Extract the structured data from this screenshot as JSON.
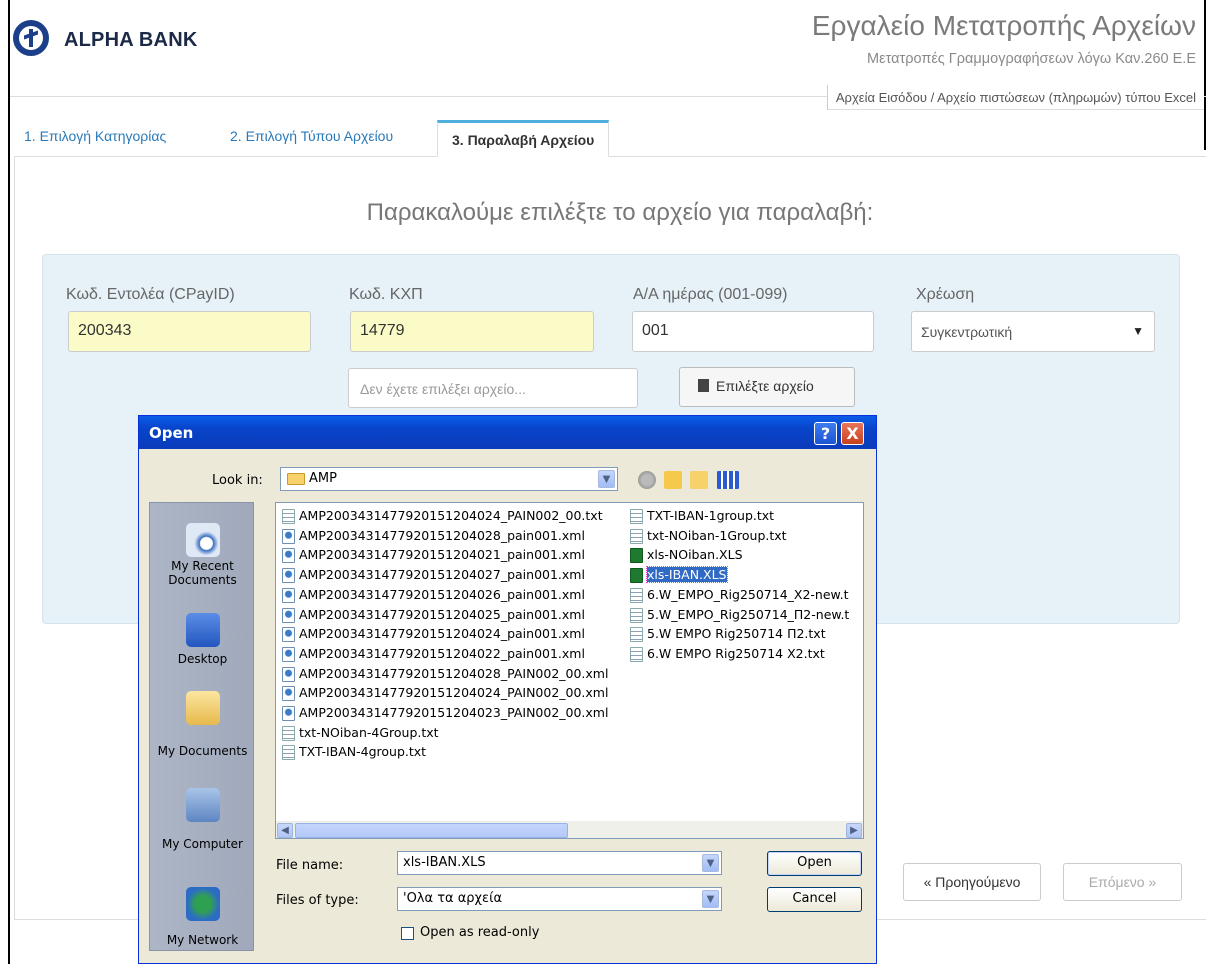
{
  "header": {
    "brand": "ALPHA BANK",
    "title": "Εργαλείο Μετατροπής Αρχείων",
    "subtitle": "Μετατροπές Γραμμογραφήσεων λόγω Καν.260 Ε.Ε",
    "breadcrumb": "Αρχεία Εισόδου / Αρχείο πιστώσεων (πληρωμών) τύπου Excel"
  },
  "tabs": [
    {
      "label": "1. Επιλογή Κατηγορίας",
      "active": false
    },
    {
      "label": "2. Επιλογή Τύπου Αρχείου",
      "active": false
    },
    {
      "label": "3. Παραλαβή Αρχείου",
      "active": true
    }
  ],
  "main": {
    "prompt": "Παρακαλούμε επιλέξτε το αρχείο για παραλαβή:",
    "fields": {
      "payer_label": "Κωδ. Εντολέα (CPayID)",
      "payer_value": "200343",
      "kxp_label": "Κωδ. ΚΧΠ",
      "kxp_value": "14779",
      "day_label": "Α/Α ημέρας (001-099)",
      "day_value": "001",
      "charge_label": "Χρέωση",
      "charge_value": "Συγκεντρωτική"
    },
    "file_placeholder": "Δεν έχετε επιλέξει αρχείο...",
    "choose_file_label": "Επιλέξτε αρχείο",
    "prev_label": "« Προηγούμενο",
    "next_label": "Επόμενο »"
  },
  "dialog": {
    "title": "Open",
    "look_in_label": "Look in:",
    "look_in_value": "AMP",
    "places": [
      {
        "label": "My Recent Documents",
        "icon": "recent-documents-icon"
      },
      {
        "label": "Desktop",
        "icon": "desktop-icon"
      },
      {
        "label": "My Documents",
        "icon": "my-documents-icon"
      },
      {
        "label": "My Computer",
        "icon": "my-computer-icon"
      },
      {
        "label": "My Network",
        "icon": "my-network-icon"
      }
    ],
    "files_col1": [
      {
        "name": "AMP200343147792015120​4024_PAIN002_00.txt",
        "type": "txt"
      },
      {
        "name": "AMP20034314779201512​04028_pain001.xml",
        "type": "xml"
      },
      {
        "name": "AMP20034314779201512​04021_pain001.xml",
        "type": "xml"
      },
      {
        "name": "AMP20034314779201512​04027_pain001.xml",
        "type": "xml"
      },
      {
        "name": "AMP20034314779201512​04026_pain001.xml",
        "type": "xml"
      },
      {
        "name": "AMP20034314779201512​04025_pain001.xml",
        "type": "xml"
      },
      {
        "name": "AMP20034314779201512​04024_pain001.xml",
        "type": "xml"
      },
      {
        "name": "AMP20034314779201512​04022_pain001.xml",
        "type": "xml"
      },
      {
        "name": "AMP20034314779201512​04028_PAIN002_00.xml",
        "type": "xml"
      },
      {
        "name": "AMP20034314779201512​04024_PAIN002_00.xml",
        "type": "xml"
      },
      {
        "name": "AMP20034314779201512​04023_PAIN002_00.xml",
        "type": "xml"
      },
      {
        "name": "txt-NOiban-4Group.txt",
        "type": "txt"
      },
      {
        "name": "TXT-IBAN-4group.txt",
        "type": "txt"
      }
    ],
    "files_col2": [
      {
        "name": "TXT-IBAN-1group.txt",
        "type": "txt"
      },
      {
        "name": "txt-NOiban-1Group.txt",
        "type": "txt"
      },
      {
        "name": "xls-NOiban.XLS",
        "type": "xls"
      },
      {
        "name": "xls-IBAN.XLS",
        "type": "xls",
        "selected": true
      },
      {
        "name": "6.W_EMPO_Rig250714_X2-new.t",
        "type": "txt"
      },
      {
        "name": "5.W_EMPO_Rig250714_Π2-new.t",
        "type": "txt"
      },
      {
        "name": "5.W EMPO Rig250714 Π2.txt",
        "type": "txt"
      },
      {
        "name": "6.W EMPO Rig250714 X2.txt",
        "type": "txt"
      }
    ],
    "file_name_label": "File name:",
    "file_name_value": "xls-IBAN.XLS",
    "file_type_label": "Files of type:",
    "file_type_value": "'Ολα τα αρχεία",
    "readonly_label": "Open as read-only",
    "open_label": "Open",
    "cancel_label": "Cancel",
    "help_glyph": "?",
    "close_glyph": "X"
  }
}
